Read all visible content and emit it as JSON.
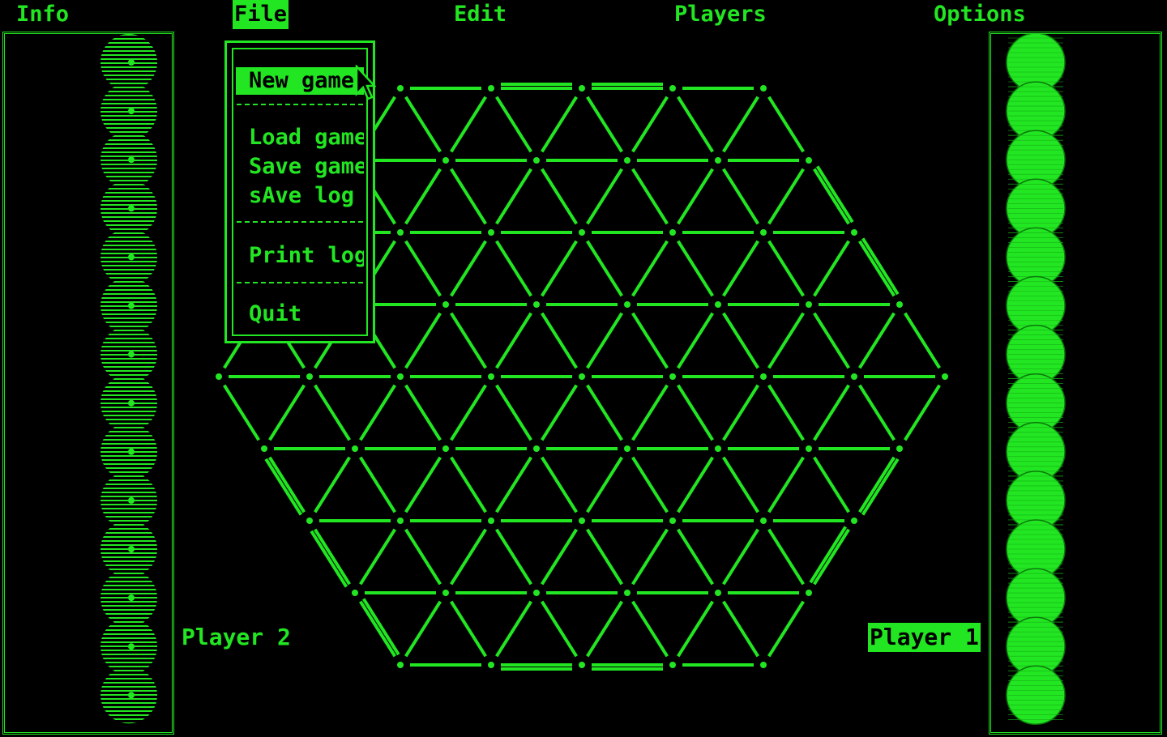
{
  "menubar": {
    "items": [
      {
        "label": "Info",
        "active": false
      },
      {
        "label": "File",
        "active": true
      },
      {
        "label": "Edit",
        "active": false
      },
      {
        "label": "Players",
        "active": false
      },
      {
        "label": "Options",
        "active": false
      }
    ]
  },
  "file_menu": {
    "new_game": "New game",
    "load_game": "Load game",
    "save_game": "Save game",
    "save_log": "sAve log",
    "print_log": "Print log",
    "quit": "Quit"
  },
  "players": {
    "player2": {
      "label": "Player 2",
      "pieces": 14,
      "active": false
    },
    "player1": {
      "label": "Player 1",
      "pieces": 14,
      "active": true
    }
  },
  "colors": {
    "phosphor": "#22e622",
    "background": "#000000"
  },
  "icons": {
    "cursor": "arrow-cursor-icon",
    "piece_p2": "striped-marble-icon",
    "piece_p1": "solid-marble-icon"
  }
}
